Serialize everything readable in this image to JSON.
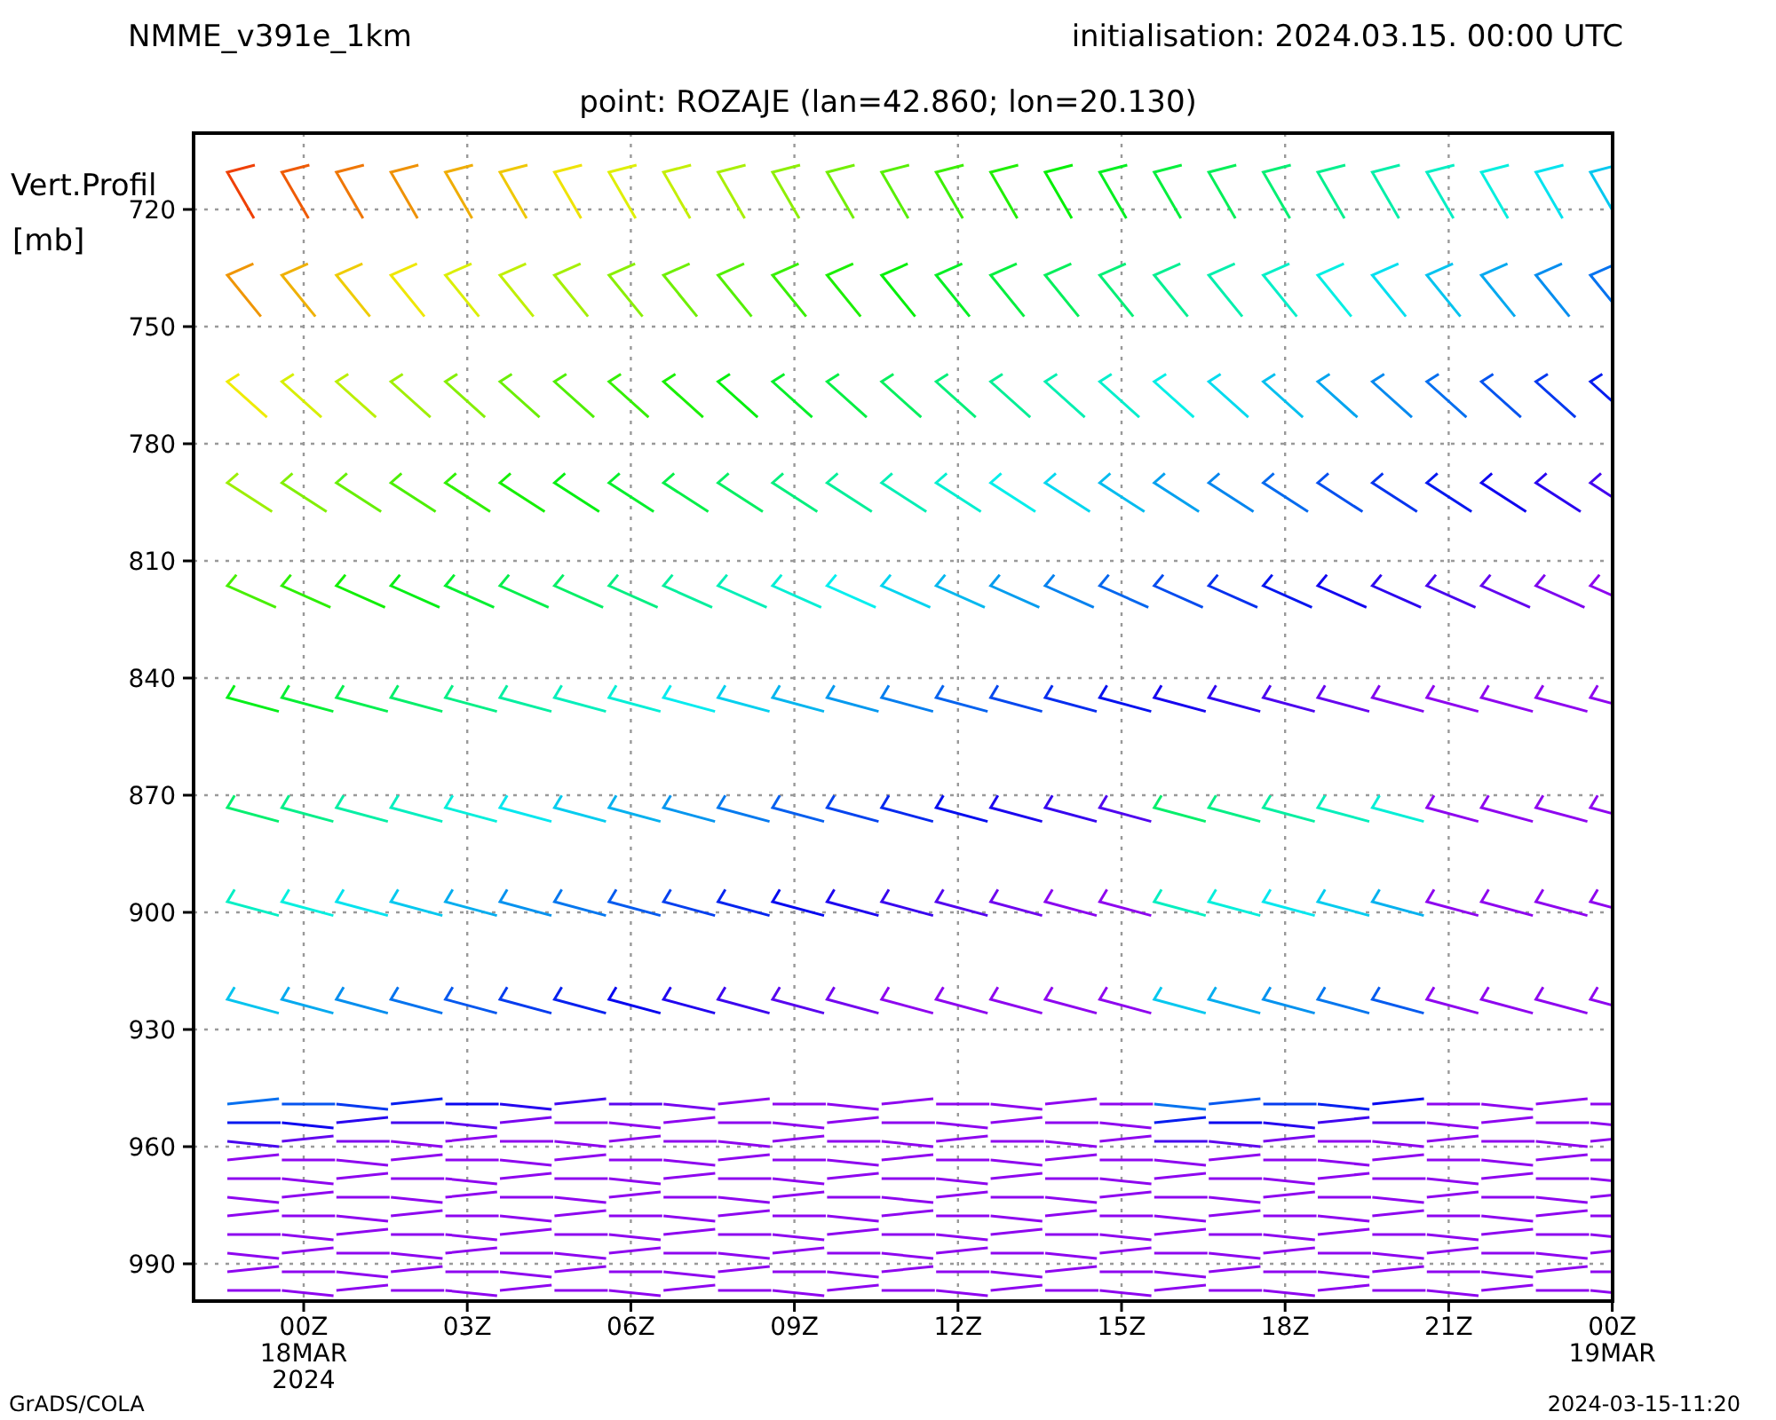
{
  "header": {
    "model": "NMME_v391e_1km",
    "initialisation": "initialisation: 2024.03.15. 00:00 UTC",
    "point": "point: ROZAJE (lan=42.860; lon=20.130)"
  },
  "y_axis": {
    "title_lines": [
      "Vert.Profil",
      "[mb]"
    ],
    "ticks": [
      "720",
      "750",
      "780",
      "810",
      "840",
      "870",
      "900",
      "930",
      "960",
      "990"
    ]
  },
  "x_axis": {
    "ticks": [
      {
        "lines": [
          "00Z",
          "18MAR",
          "2024"
        ]
      },
      {
        "lines": [
          "03Z"
        ]
      },
      {
        "lines": [
          "06Z"
        ]
      },
      {
        "lines": [
          "09Z"
        ]
      },
      {
        "lines": [
          "12Z"
        ]
      },
      {
        "lines": [
          "15Z"
        ]
      },
      {
        "lines": [
          "18Z"
        ]
      },
      {
        "lines": [
          "21Z"
        ]
      },
      {
        "lines": [
          "00Z",
          "19MAR"
        ]
      }
    ]
  },
  "footer": {
    "credit": "GrADS/COLA",
    "timestamp": "2024-03-15-11:20"
  }
}
